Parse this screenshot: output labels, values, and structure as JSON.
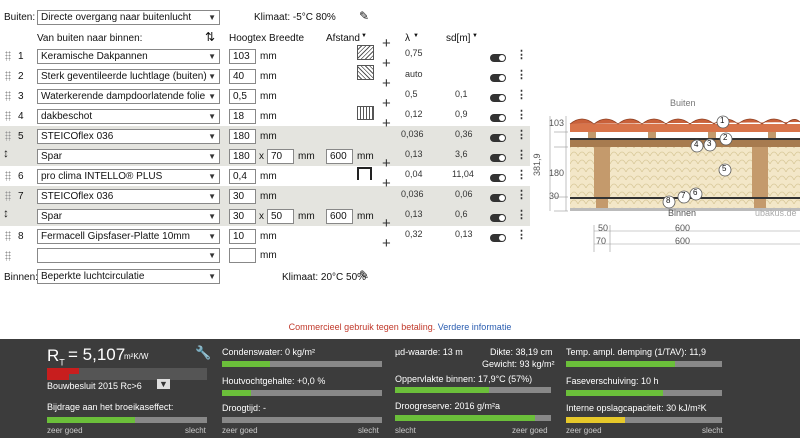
{
  "outside": {
    "label": "Buiten:",
    "value": "Directe overgang naar buitenlucht",
    "climate": "Klimaat: -5°C 80%"
  },
  "inside": {
    "label": "Binnen:",
    "value": "Beperkte luchtcirculatie",
    "climate": "Klimaat: 20°C 50%"
  },
  "headers": {
    "from": "Van buiten naar binnen:",
    "hoogtex": "Hoogtex Breedte",
    "afstand": "Afstand",
    "lambda": "λ",
    "sd": "sd[m]"
  },
  "unit_mm": "mm",
  "x_sep": "x",
  "rows": [
    {
      "num": "1",
      "name": "Keramische Dakpannen",
      "h": "103",
      "lambda": "0,75",
      "sd": ""
    },
    {
      "num": "2",
      "name": "Sterk geventileerde luchtlage (buiten)",
      "h": "40",
      "lambda": "auto",
      "sd": ""
    },
    {
      "num": "3",
      "name": "Waterkerende dampdoorlatende folie",
      "h": "0,5",
      "lambda": "0,5",
      "sd": "0,1"
    },
    {
      "num": "4",
      "name": "dakbeschot",
      "h": "18",
      "lambda": "0,12",
      "sd": "0,9"
    },
    {
      "num": "5",
      "name": "STEICOflex 036",
      "h": "180",
      "lambda": "0,036",
      "sd": "0,36"
    },
    {
      "num": "",
      "name": "Spar",
      "h": "180",
      "w": "70",
      "dist": "600",
      "lambda": "0,13",
      "sd": "3,6"
    },
    {
      "num": "6",
      "name": "pro clima INTELLO® PLUS",
      "h": "0,4",
      "lambda": "0,04",
      "sd": "11,04"
    },
    {
      "num": "7",
      "name": "STEICOflex 036",
      "h": "30",
      "lambda": "0,036",
      "sd": "0,06"
    },
    {
      "num": "",
      "name": "Spar",
      "h": "30",
      "w": "50",
      "dist": "600",
      "lambda": "0,13",
      "sd": "0,6"
    },
    {
      "num": "8",
      "name": "Fermacell Gipsfaser-Platte 10mm",
      "h": "10",
      "lambda": "0,32",
      "sd": "0,13"
    },
    {
      "num": "",
      "name": "",
      "h": "",
      "lambda": "",
      "sd": ""
    }
  ],
  "diagram": {
    "top": "Buiten",
    "bottom": "Binnen",
    "brand": "ubakus.de",
    "left_dims": [
      "103",
      "180",
      "30"
    ],
    "total": "381,9",
    "width_top": "600",
    "left_small": "50",
    "left_small2": "70",
    "width_bottom": "600",
    "markers": [
      "1",
      "2",
      "3",
      "4",
      "5",
      "6",
      "7",
      "8"
    ]
  },
  "notice": {
    "text": "Commercieel gebruik tegen betaling.",
    "link": "Verdere informatie"
  },
  "results": {
    "rt_label": "R",
    "rt_sub": "T",
    "rt_value": "= 5,107",
    "rt_unit": "m²K/W",
    "standard": "Bouwbesluit 2015 Rc>6",
    "greenhouse": "Bijdrage aan het broeikaseffect:",
    "condensate": "Condenswater: 0 kg/m²",
    "wood_moisture": "Houtvochtgehalte: +0,0 %",
    "dry_time": "Droogtijd: -",
    "mud": "µd-waarde: 13 m",
    "thickness": "Dikte: 38,19 cm",
    "weight": "Gewicht: 93 kg/m²",
    "surface_inside": "Oppervlakte binnen: 17,9°C (57%)",
    "dry_reserve": "Droogreserve: 2016 g/m²a",
    "temp_ampl": "Temp. ampl. demping (1/TAV): 11,9",
    "phase_shift": "Faseverschuiving: 10 h",
    "heat_capacity": "Interne opslagcapaciteit: 30 kJ/m²K",
    "good": "zeer goed",
    "bad": "slecht"
  },
  "colors": {
    "green": "#6bbf3a",
    "yellow": "#e6c82a",
    "red": "#c81e1e"
  }
}
